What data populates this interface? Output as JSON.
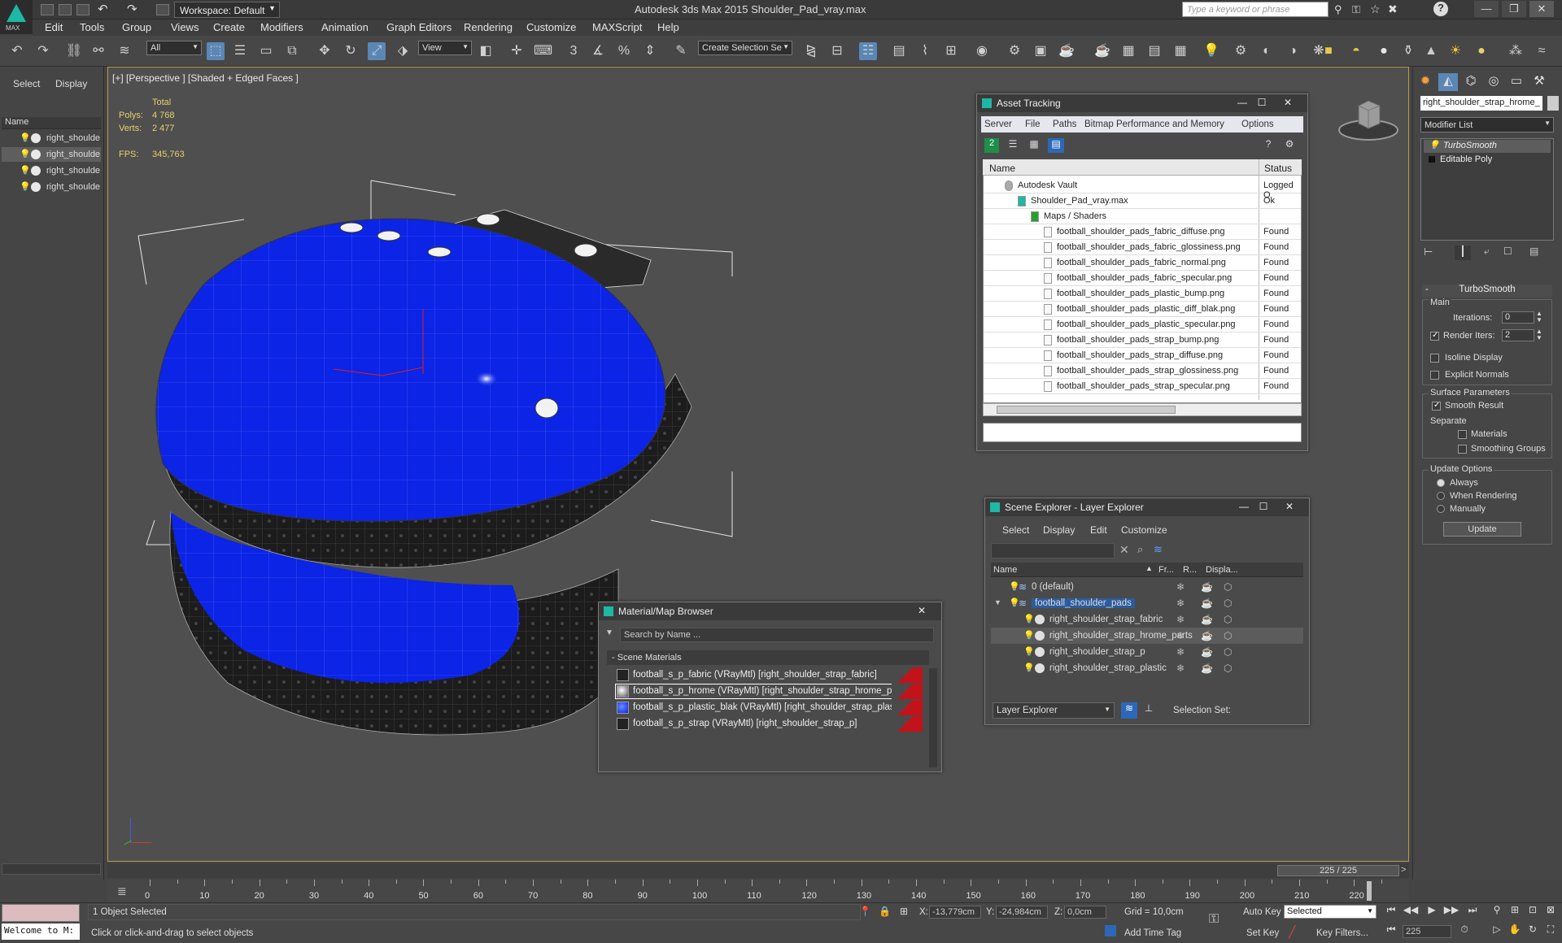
{
  "titlebar": {
    "app_title": "Autodesk 3ds Max  2015     Shoulder_Pad_vray.max",
    "workspace": "Workspace: Default",
    "search_placeholder": "Type a keyword or phrase",
    "logo_label": "MAX"
  },
  "menubar": [
    "Edit",
    "Tools",
    "Group",
    "Views",
    "Create",
    "Modifiers",
    "Animation",
    "Graph Editors",
    "Rendering",
    "Customize",
    "MAXScript",
    "Help"
  ],
  "toolbar": {
    "filter": "All",
    "ref_coord": "View",
    "selection_set": "Create Selection Se",
    "snap_3": "3"
  },
  "left_panel": {
    "tabs": [
      "Select",
      "Display"
    ],
    "column": "Name",
    "items": [
      "right_shoulde",
      "right_shoulde",
      "right_shoulde",
      "right_shoulde"
    ],
    "selected_index": 1
  },
  "viewport": {
    "label": "[+] [Perspective ] [Shaded + Edged Faces ]",
    "stats": {
      "total_label": "Total",
      "polys_label": "Polys:",
      "polys": "4 768",
      "verts_label": "Verts:",
      "verts": "2 477",
      "fps_label": "FPS:",
      "fps": "345,763"
    }
  },
  "asset_tracking": {
    "title": "Asset Tracking",
    "menu": [
      "Server",
      "File",
      "Paths",
      "Bitmap Performance and Memory",
      "Options"
    ],
    "columns": {
      "name": "Name",
      "status": "Status"
    },
    "rows": [
      {
        "name": "Autodesk Vault",
        "status": "Logged O",
        "indent": 1
      },
      {
        "name": "Shoulder_Pad_vray.max",
        "status": "Ok",
        "indent": 2
      },
      {
        "name": "Maps / Shaders",
        "status": "",
        "indent": 3
      },
      {
        "name": "football_shoulder_pads_fabric_diffuse.png",
        "status": "Found",
        "indent": 4
      },
      {
        "name": "football_shoulder_pads_fabric_glossiness.png",
        "status": "Found",
        "indent": 4
      },
      {
        "name": "football_shoulder_pads_fabric_normal.png",
        "status": "Found",
        "indent": 4
      },
      {
        "name": "football_shoulder_pads_fabric_specular.png",
        "status": "Found",
        "indent": 4
      },
      {
        "name": "football_shoulder_pads_plastic_bump.png",
        "status": "Found",
        "indent": 4
      },
      {
        "name": "football_shoulder_pads_plastic_diff_blak.png",
        "status": "Found",
        "indent": 4
      },
      {
        "name": "football_shoulder_pads_plastic_specular.png",
        "status": "Found",
        "indent": 4
      },
      {
        "name": "football_shoulder_pads_strap_bump.png",
        "status": "Found",
        "indent": 4
      },
      {
        "name": "football_shoulder_pads_strap_diffuse.png",
        "status": "Found",
        "indent": 4
      },
      {
        "name": "football_shoulder_pads_strap_glossiness.png",
        "status": "Found",
        "indent": 4
      },
      {
        "name": "football_shoulder_pads_strap_specular.png",
        "status": "Found",
        "indent": 4
      }
    ]
  },
  "scene_explorer": {
    "title": "Scene Explorer - Layer Explorer",
    "menu": [
      "Select",
      "Display",
      "Edit",
      "Customize"
    ],
    "columns": [
      "Name",
      "Fr...",
      "R...",
      "Displa..."
    ],
    "rows": [
      {
        "name": "0 (default)",
        "kind": "layer"
      },
      {
        "name": "football_shoulder_pads",
        "kind": "layer-selected"
      },
      {
        "name": "right_shoulder_strap_fabric",
        "kind": "object"
      },
      {
        "name": "right_shoulder_strap_hrome_parts",
        "kind": "object-highlight"
      },
      {
        "name": "right_shoulder_strap_p",
        "kind": "object"
      },
      {
        "name": "right_shoulder_strap_plastic",
        "kind": "object"
      }
    ],
    "footer_mode": "Layer Explorer",
    "selection_set_label": "Selection Set:"
  },
  "material_browser": {
    "title": "Material/Map Browser",
    "search_placeholder": "Search by Name ...",
    "group": "Scene Materials",
    "items": [
      "football_s_p_fabric (VRayMtl) [right_shoulder_strap_fabric]",
      "football_s_p_hrome (VRayMtl) [right_shoulder_strap_hrome_parts]",
      "football_s_p_plastic_blak (VRayMtl) [right_shoulder_strap_plastic]",
      "football_s_p_strap (VRayMtl) [right_shoulder_strap_p]"
    ],
    "selected_index": 1
  },
  "command_panel": {
    "object_name": "right_shoulder_strap_hrome_",
    "modifier_list": "Modifier List",
    "stack": [
      "TurboSmooth",
      "Editable Poly"
    ],
    "rollout_title": "TurboSmooth",
    "main_label": "Main",
    "iterations_label": "Iterations:",
    "iterations": "0",
    "render_iters_label": "Render Iters:",
    "render_iters": "2",
    "isoline": "Isoline Display",
    "explicit_normals": "Explicit Normals",
    "surface_params": "Surface Parameters",
    "smooth_result": "Smooth Result",
    "separate": "Separate",
    "materials": "Materials",
    "smoothing_groups": "Smoothing Groups",
    "update_options": "Update Options",
    "always": "Always",
    "when_rendering": "When Rendering",
    "manually": "Manually",
    "update_button": "Update"
  },
  "timeline": {
    "frame_display": "225 / 225",
    "ticks": [
      "0",
      "10",
      "20",
      "30",
      "40",
      "50",
      "60",
      "70",
      "80",
      "90",
      "100",
      "110",
      "120",
      "130",
      "140",
      "150",
      "160",
      "170",
      "180",
      "190",
      "200",
      "210",
      "220"
    ],
    "current_frame": 225,
    "total_frames": 225
  },
  "status": {
    "welcome": "Welcome to M:",
    "selected": "1 Object Selected",
    "hint": "Click or click-and-drag to select objects",
    "x_label": "X:",
    "x": "-13,779cm",
    "y_label": "Y:",
    "y": "-24,984cm",
    "z_label": "Z:",
    "z": "0,0cm",
    "grid": "Grid = 10,0cm",
    "add_time_tag": "Add Time Tag",
    "auto_key": "Auto Key",
    "set_key": "Set Key",
    "key_mode": "Selected",
    "key_filters": "Key Filters...",
    "frame": "225"
  },
  "colors": {
    "accent": "#1fb7a6",
    "selection_blue": "#2b5c9e",
    "mesh_blue": "#0b24e6",
    "viewport_bg": "#4f4f4f"
  }
}
